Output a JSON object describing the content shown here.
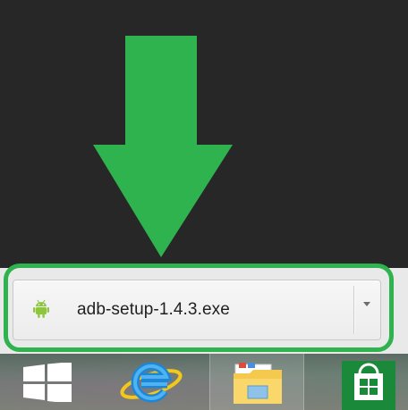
{
  "download": {
    "file_name": "adb-setup-1.4.3.exe",
    "file_icon": "android-icon",
    "menu_icon": "chevron-down-icon"
  },
  "annotation": {
    "arrow_color": "#2fb34e",
    "highlight_color": "#2fb34e"
  },
  "taskbar": {
    "items": [
      {
        "name": "windows-start",
        "icon": "windows-logo-icon"
      },
      {
        "name": "internet-explorer",
        "icon": "internet-explorer-icon"
      },
      {
        "name": "file-explorer",
        "icon": "folder-icon"
      },
      {
        "name": "windows-store",
        "icon": "store-bag-icon"
      }
    ]
  }
}
